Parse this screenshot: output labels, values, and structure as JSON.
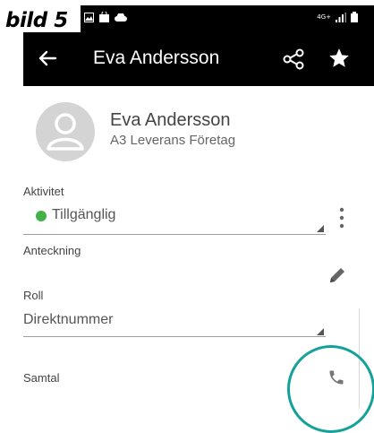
{
  "caption": "bild 5",
  "header": {
    "title": "Eva Andersson"
  },
  "contact": {
    "name": "Eva Andersson",
    "company": "A3 Leverans Företag"
  },
  "activity": {
    "label": "Aktivitet",
    "status": "Tillgänglig",
    "status_color": "#43b049"
  },
  "note": {
    "label": "Anteckning"
  },
  "role": {
    "label": "Roll",
    "value": "Direktnummer"
  },
  "call": {
    "label": "Samtal"
  },
  "status_bar": {
    "network": "4G+"
  },
  "colors": {
    "appbar": "#000000",
    "highlight_ring": "#14a298"
  }
}
